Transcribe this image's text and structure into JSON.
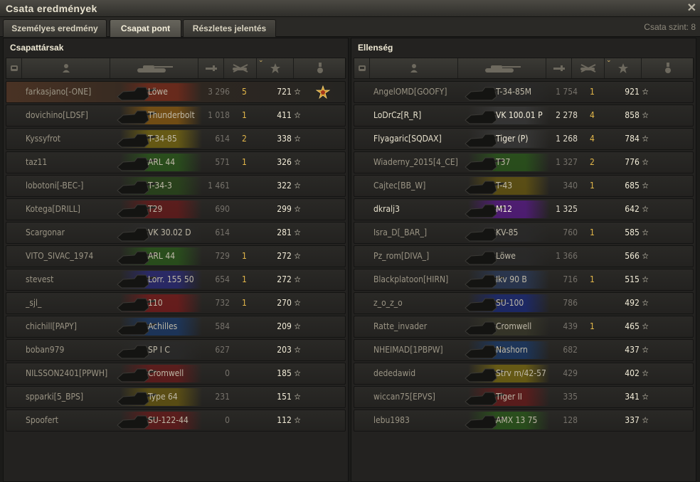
{
  "window": {
    "title": "Csata eredmények",
    "close_label": "✕"
  },
  "tabs": [
    {
      "label": "Személyes eredmény",
      "active": false
    },
    {
      "label": "Csapat pont",
      "active": true
    },
    {
      "label": "Részletes jelentés",
      "active": false
    }
  ],
  "battle_level": "Csata szint: 8",
  "teams": [
    {
      "title": "Csapattársak",
      "rows": [
        {
          "player": "farkasjano[-ONE]",
          "tank": "Löwe",
          "damage": "3 296",
          "kills": "5",
          "xp": "721 ☆",
          "color": "#7a2a1a",
          "highlight": true,
          "medal": true,
          "bright": false
        },
        {
          "player": "dovichino[LDSF]",
          "tank": "Thunderbolt",
          "damage": "1 018",
          "kills": "1",
          "xp": "411 ☆",
          "color": "#8a5a10",
          "highlight": false,
          "medal": false,
          "bright": false
        },
        {
          "player": "Kyssyfrot",
          "tank": "T-34-85",
          "damage": "614",
          "kills": "2",
          "xp": "338 ☆",
          "color": "#7a6a10",
          "highlight": false,
          "medal": false,
          "bright": false
        },
        {
          "player": "taz11",
          "tank": "ARL 44",
          "damage": "571",
          "kills": "1",
          "xp": "326 ☆",
          "color": "#2a5a1a",
          "highlight": false,
          "medal": false,
          "bright": false
        },
        {
          "player": "lobotoni[-BEC-]",
          "tank": "T-34-3",
          "damage": "1 461",
          "kills": "",
          "xp": "322 ☆",
          "color": "#2a4a1a",
          "highlight": false,
          "medal": false,
          "bright": false
        },
        {
          "player": "Kotega[DRILL]",
          "tank": "T29",
          "damage": "690",
          "kills": "",
          "xp": "299 ☆",
          "color": "#6a1a1a",
          "highlight": false,
          "medal": false,
          "bright": false
        },
        {
          "player": "Scargonar",
          "tank": "VK 30.02 D",
          "damage": "614",
          "kills": "",
          "xp": "281 ☆",
          "color": "#2a2a2a",
          "highlight": false,
          "medal": false,
          "bright": false
        },
        {
          "player": "VITO_SIVAC_1974",
          "tank": "ARL 44",
          "damage": "729",
          "kills": "1",
          "xp": "272 ☆",
          "color": "#2a5a1a",
          "highlight": false,
          "medal": false,
          "bright": false
        },
        {
          "player": "stevest",
          "tank": "Lorr. 155 50",
          "damage": "654",
          "kills": "1",
          "xp": "272 ☆",
          "color": "#2a2a7a",
          "highlight": false,
          "medal": false,
          "bright": false
        },
        {
          "player": "_sjl_",
          "tank": "110",
          "damage": "732",
          "kills": "1",
          "xp": "270 ☆",
          "color": "#7a1a1a",
          "highlight": false,
          "medal": false,
          "bright": false
        },
        {
          "player": "chichill[PAPY]",
          "tank": "Achilles",
          "damage": "584",
          "kills": "",
          "xp": "209 ☆",
          "color": "#1a3a6a",
          "highlight": false,
          "medal": false,
          "bright": false
        },
        {
          "player": "boban979",
          "tank": "SP I C",
          "damage": "627",
          "kills": "",
          "xp": "203 ☆",
          "color": "#2a2a2a",
          "highlight": false,
          "medal": false,
          "bright": false
        },
        {
          "player": "NILSSON2401[PPWH]",
          "tank": "Cromwell",
          "damage": "0",
          "kills": "",
          "xp": "185 ☆",
          "color": "#6a1a1a",
          "highlight": false,
          "medal": false,
          "bright": false
        },
        {
          "player": "spparki[5_BPS]",
          "tank": "Type 64",
          "damage": "231",
          "kills": "",
          "xp": "151 ☆",
          "color": "#6a5a10",
          "highlight": false,
          "medal": false,
          "bright": false
        },
        {
          "player": "Spoofert",
          "tank": "SU-122-44",
          "damage": "0",
          "kills": "",
          "xp": "112 ☆",
          "color": "#6a1a1a",
          "highlight": false,
          "medal": false,
          "bright": false
        }
      ]
    },
    {
      "title": "Ellenség",
      "rows": [
        {
          "player": "AngelOMD[GOOFY]",
          "tank": "T-34-85M",
          "damage": "1 754",
          "kills": "1",
          "xp": "921 ☆",
          "color": "#2a2a2a",
          "highlight": false,
          "medal": false,
          "bright": false
        },
        {
          "player": "LoDrCz[R_R]",
          "tank": "VK 100.01 P",
          "damage": "2 278",
          "kills": "4",
          "xp": "858 ☆",
          "color": "#3a3a3a",
          "highlight": false,
          "medal": false,
          "bright": true
        },
        {
          "player": "Flyagaric[SQDAX]",
          "tank": "Tiger (P)",
          "damage": "1 268",
          "kills": "4",
          "xp": "784 ☆",
          "color": "#3a3a3a",
          "highlight": false,
          "medal": false,
          "bright": true
        },
        {
          "player": "Wiaderny_2015[4_CE]",
          "tank": "T37",
          "damage": "1 327",
          "kills": "2",
          "xp": "776 ☆",
          "color": "#2a5a1a",
          "highlight": false,
          "medal": false,
          "bright": false
        },
        {
          "player": "Cajtec[BB_W]",
          "tank": "T-43",
          "damage": "340",
          "kills": "1",
          "xp": "685 ☆",
          "color": "#6a5a10",
          "highlight": false,
          "medal": false,
          "bright": false
        },
        {
          "player": "dkralj3",
          "tank": "M12",
          "damage": "1 325",
          "kills": "",
          "xp": "642 ☆",
          "color": "#5a1a8a",
          "highlight": false,
          "medal": false,
          "bright": true
        },
        {
          "player": "Isra_D[_BAR_]",
          "tank": "KV-85",
          "damage": "760",
          "kills": "1",
          "xp": "585 ☆",
          "color": "#2a2a2a",
          "highlight": false,
          "medal": false,
          "bright": false
        },
        {
          "player": "Pz_rom[DIVA_]",
          "tank": "Löwe",
          "damage": "1 366",
          "kills": "",
          "xp": "566 ☆",
          "color": "#2a2a2a",
          "highlight": false,
          "medal": false,
          "bright": false
        },
        {
          "player": "Blackplatoon[HIRN]",
          "tank": "Ikv 90 B",
          "damage": "716",
          "kills": "1",
          "xp": "515 ☆",
          "color": "#2a3a5a",
          "highlight": false,
          "medal": false,
          "bright": false
        },
        {
          "player": "z_o_z_o",
          "tank": "SU-100",
          "damage": "786",
          "kills": "",
          "xp": "492 ☆",
          "color": "#1a2a7a",
          "highlight": false,
          "medal": false,
          "bright": false
        },
        {
          "player": "Ratte_invader",
          "tank": "Cromwell",
          "damage": "439",
          "kills": "1",
          "xp": "465 ☆",
          "color": "#3a3a2a",
          "highlight": false,
          "medal": false,
          "bright": false
        },
        {
          "player": "NHEIMAD[1PBPW]",
          "tank": "Nashorn",
          "damage": "682",
          "kills": "",
          "xp": "437 ☆",
          "color": "#1a3a6a",
          "highlight": false,
          "medal": false,
          "bright": false
        },
        {
          "player": "dededawid",
          "tank": "Strv m/42-57",
          "damage": "429",
          "kills": "",
          "xp": "402 ☆",
          "color": "#7a6a10",
          "highlight": false,
          "medal": false,
          "bright": false
        },
        {
          "player": "wiccan75[EPVS]",
          "tank": "Tiger II",
          "damage": "335",
          "kills": "",
          "xp": "341 ☆",
          "color": "#6a1a1a",
          "highlight": false,
          "medal": false,
          "bright": false
        },
        {
          "player": "lebu1983",
          "tank": "AMX 13 75",
          "damage": "128",
          "kills": "",
          "xp": "337 ☆",
          "color": "#2a5a1a",
          "highlight": false,
          "medal": false,
          "bright": false
        }
      ]
    }
  ]
}
